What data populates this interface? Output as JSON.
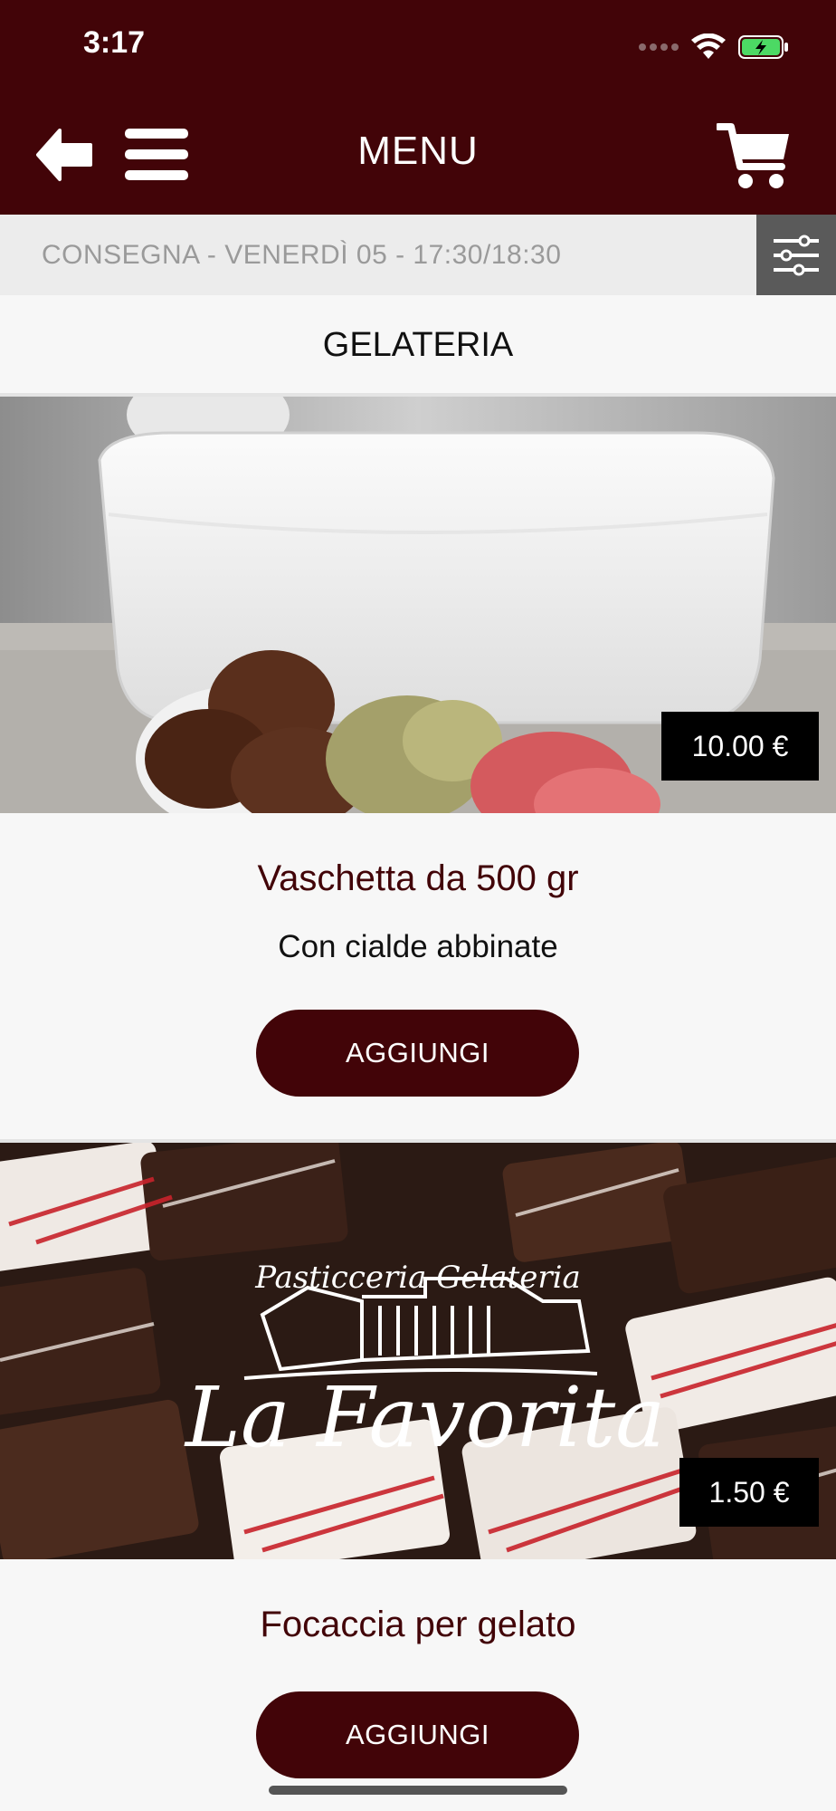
{
  "status_bar": {
    "time": "3:17"
  },
  "nav": {
    "title": "MENU",
    "back_icon": "arrow-left-icon",
    "menu_icon": "hamburger-icon",
    "cart_icon": "cart-icon"
  },
  "delivery": {
    "text": "CONSEGNA - VENERDÌ 05 - 17:30/18:30",
    "filter_icon": "sliders-icon"
  },
  "section": {
    "title": "GELATERIA"
  },
  "products": [
    {
      "name": "Vaschetta da 500 gr",
      "description": "Con cialde abbinate",
      "price": "10.00 €",
      "button_label": "AGGIUNGI",
      "image": "gelato-tub-image"
    },
    {
      "name": "Focaccia per gelato",
      "price": "1.50 €",
      "button_label": "AGGIUNGI",
      "image": "chocolates-logo-image",
      "logo_text_top": "Pasticceria Gelateria",
      "logo_text_main": "La Favorita"
    }
  ],
  "colors": {
    "brand": "#420408",
    "price_badge": "#000000",
    "filter_button": "#5a5a5a"
  }
}
